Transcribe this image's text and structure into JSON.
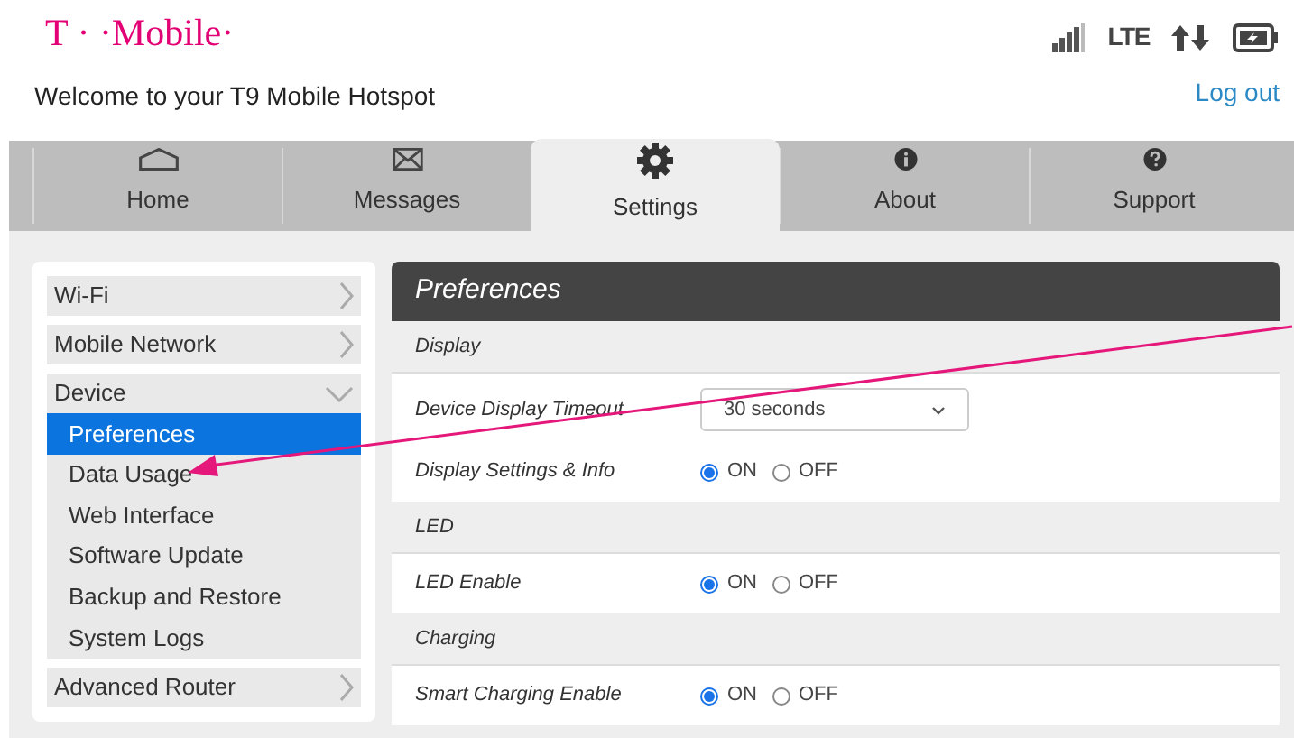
{
  "header": {
    "logo": "T · ·Mobile·",
    "network": "LTE",
    "welcome": "Welcome to your T9 Mobile Hotspot",
    "logout": "Log out"
  },
  "tabs": [
    {
      "label": "Home",
      "selected": false
    },
    {
      "label": "Messages",
      "selected": false
    },
    {
      "label": "Settings",
      "selected": true
    },
    {
      "label": "About",
      "selected": false
    },
    {
      "label": "Support",
      "selected": false
    }
  ],
  "sidebar": {
    "items": [
      {
        "label": "Wi-Fi",
        "expanded": false
      },
      {
        "label": "Mobile Network",
        "expanded": false
      },
      {
        "label": "Device",
        "expanded": true,
        "children": [
          {
            "label": "Preferences",
            "selected": true
          },
          {
            "label": "Data Usage",
            "selected": false
          },
          {
            "label": "Web Interface",
            "selected": false
          },
          {
            "label": "Software Update",
            "selected": false
          },
          {
            "label": "Backup and Restore",
            "selected": false
          },
          {
            "label": "System Logs",
            "selected": false
          }
        ]
      },
      {
        "label": "Advanced Router",
        "expanded": false
      }
    ]
  },
  "panel": {
    "title": "Preferences",
    "rows": [
      {
        "kind": "section",
        "label": "Display"
      },
      {
        "kind": "select",
        "label": "Device Display Timeout",
        "value": "30 seconds"
      },
      {
        "kind": "radio",
        "label": "Display Settings & Info",
        "options": [
          {
            "label": "ON",
            "selected": true
          },
          {
            "label": "OFF",
            "selected": false
          }
        ]
      },
      {
        "kind": "section",
        "label": "LED"
      },
      {
        "kind": "radio",
        "label": "LED Enable",
        "options": [
          {
            "label": "ON",
            "selected": true
          },
          {
            "label": "OFF",
            "selected": false
          }
        ]
      },
      {
        "kind": "section",
        "label": "Charging"
      },
      {
        "kind": "radio",
        "label": "Smart Charging Enable",
        "options": [
          {
            "label": "ON",
            "selected": true
          },
          {
            "label": "OFF",
            "selected": false
          }
        ]
      }
    ]
  }
}
